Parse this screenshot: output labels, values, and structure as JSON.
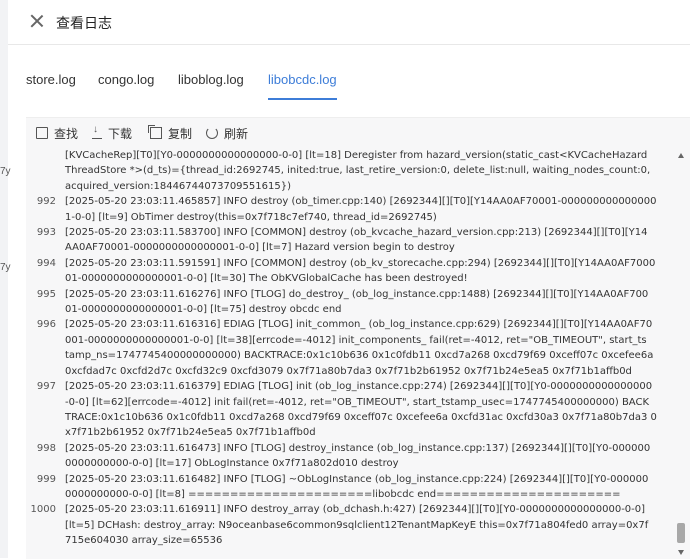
{
  "dialog": {
    "title": "查看日志"
  },
  "background_fragments": [
    "7y",
    "7y"
  ],
  "tabs": [
    {
      "label": "store.log",
      "active": false
    },
    {
      "label": "congo.log",
      "active": false
    },
    {
      "label": "liboblog.log",
      "active": false
    },
    {
      "label": "libobcdc.log",
      "active": true
    }
  ],
  "toolbar": {
    "find": "查找",
    "download": "下载",
    "copy": "复制",
    "refresh": "刷新"
  },
  "log_entries": [
    {
      "num": "",
      "lines": [
        "[KVCacheRep][T0][Y0-0000000000000000-0-0] [lt=18] Deregister from hazard_version(static_cast<KVCacheHazard",
        "ThreadStore *>(d_ts)={thread_id:2692745, inited:true, last_retire_version:0, delete_list:null, waiting_nodes_count:0,",
        "acquired_version:18446744073709551615})"
      ]
    },
    {
      "num": "992",
      "lines": [
        "[2025-05-20 23:03:11.465857] INFO destroy (ob_timer.cpp:140) [2692344][][T0][Y14AA0AF70001-000000000000000",
        "1-0-0] [lt=9] ObTimer destroy(this=0x7f718c7ef740, thread_id=2692745)"
      ]
    },
    {
      "num": "993",
      "lines": [
        "[2025-05-20 23:03:11.583700] INFO [COMMON] destroy (ob_kvcache_hazard_version.cpp:213) [2692344][][T0][Y14",
        "AA0AF70001-0000000000000001-0-0] [lt=7] Hazard version begin to destroy"
      ]
    },
    {
      "num": "994",
      "lines": [
        "[2025-05-20 23:03:11.591591] INFO [COMMON] destroy (ob_kv_storecache.cpp:294) [2692344][][T0][Y14AA0AF7000",
        "01-0000000000000001-0-0] [lt=30] The ObKVGlobalCache has been destroyed!"
      ]
    },
    {
      "num": "995",
      "lines": [
        "[2025-05-20 23:03:11.616276] INFO [TLOG] do_destroy_ (ob_log_instance.cpp:1488) [2692344][][T0][Y14AA0AF700",
        "01-0000000000000001-0-0] [lt=75] destroy obcdc end"
      ]
    },
    {
      "num": "996",
      "lines": [
        "[2025-05-20 23:03:11.616316] EDIAG [TLOG] init_common_ (ob_log_instance.cpp:629) [2692344][][T0][Y14AA0AF70",
        "001-0000000000000001-0-0] [lt=38][errcode=-4012] init_components_ fail(ret=-4012, ret=\"OB_TIMEOUT\", start_ts",
        "tamp_ns=1747745400000000000) BACKTRACE:0x1c10b636 0x1c0fdb11 0xcd7a268 0xcd79f69 0xceff07c 0xcefee6a",
        "0xcfdad7c 0xcfd2d7c 0xcfd32c9 0xcfd3079 0x7f71a80b7da3 0x7f71b2b61952 0x7f71b24e5ea5 0x7f71b1affb0d"
      ]
    },
    {
      "num": "997",
      "lines": [
        "[2025-05-20 23:03:11.616379] EDIAG [TLOG] init (ob_log_instance.cpp:274) [2692344][][T0][Y0-0000000000000000",
        "-0-0] [lt=62][errcode=-4012] init fail(ret=-4012, ret=\"OB_TIMEOUT\", start_tstamp_usec=1747745400000000) BACK",
        "TRACE:0x1c10b636 0x1c0fdb11 0xcd7a268 0xcd79f69 0xceff07c 0xcefee6a 0xcfd31ac 0xcfd30a3 0x7f71a80b7da3 0",
        "x7f71b2b61952 0x7f71b24e5ea5 0x7f71b1affb0d"
      ]
    },
    {
      "num": "998",
      "lines": [
        "[2025-05-20 23:03:11.616473] INFO [TLOG] destroy_instance (ob_log_instance.cpp:137) [2692344][][T0][Y0-000000",
        "0000000000-0-0] [lt=17] ObLogInstance 0x7f71a802d010 destroy"
      ]
    },
    {
      "num": "999",
      "lines": [
        "[2025-05-20 23:03:11.616482] INFO [TLOG] ~ObLogInstance (ob_log_instance.cpp:224) [2692344][][T0][Y0-000000",
        "0000000000-0-0] [lt=8] ======================libobcdc end======================"
      ]
    },
    {
      "num": "1000",
      "lines": [
        " [2025-05-20 23:03:11.616911] INFO destroy_array (ob_dchash.h:427) [2692344][][T0][Y0-0000000000000000-0-0]",
        "[lt=5] DCHash: destroy_array: N9oceanbase6common9sqlclient12TenantMapKeyE this=0x7f71a804fed0 array=0x7f",
        "715e604030 array_size=65536"
      ]
    }
  ]
}
